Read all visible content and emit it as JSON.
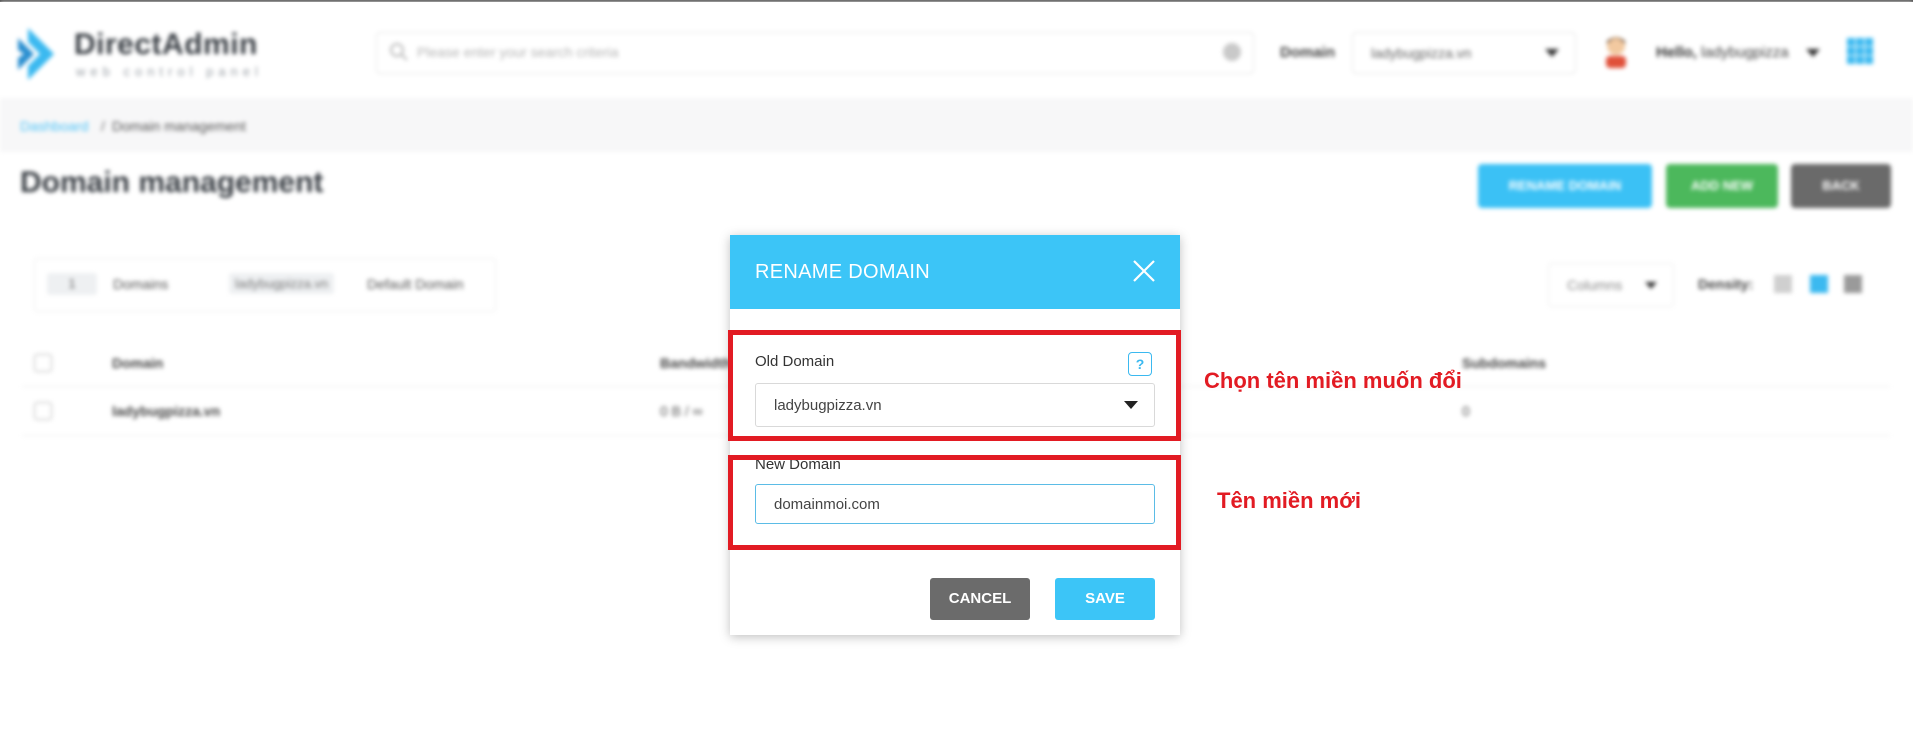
{
  "header": {
    "logo_title": "DirectAdmin",
    "logo_subtitle": "web control panel",
    "search_placeholder": "Please enter your search criteria",
    "domain_label": "Domain",
    "domain_value": "ladybugpizza.vn",
    "hello_prefix": "Hello,",
    "hello_user": "ladybugpizza"
  },
  "breadcrumb": {
    "home": "Dashboard",
    "separator": "/",
    "current": "Domain management"
  },
  "page": {
    "title": "Domain management",
    "actions": {
      "rename": "RENAME DOMAIN",
      "add_new": "ADD NEW",
      "back": "BACK"
    }
  },
  "filters": {
    "count": "1",
    "count_label": "Domains",
    "chip": "ladybugpizza.vn",
    "default_label": "Default Domain",
    "columns_label": "Columns",
    "density_label": "Density:"
  },
  "table": {
    "headers": {
      "domain": "Domain",
      "bandwidth": "Bandwidth",
      "subdomains": "Subdomains"
    },
    "rows": [
      {
        "domain": "ladybugpizza.vn",
        "bandwidth": "0 B / ∞",
        "subdomains": "0"
      }
    ]
  },
  "modal": {
    "title": "RENAME DOMAIN",
    "old_domain_label": "Old Domain",
    "help_icon_text": "?",
    "old_domain_value": "ladybugpizza.vn",
    "new_domain_label": "New Domain",
    "new_domain_value": "domainmoi.com",
    "cancel_label": "CANCEL",
    "save_label": "SAVE"
  },
  "annotations": {
    "old_domain_note": "Chọn tên miền muốn đổi",
    "new_domain_note": "Tên miền mới",
    "highlight_color": "#e21b23"
  },
  "colors": {
    "accent": "#3cc5f7",
    "add_green": "#4cb85c",
    "back_gray": "#6a6a6a"
  }
}
